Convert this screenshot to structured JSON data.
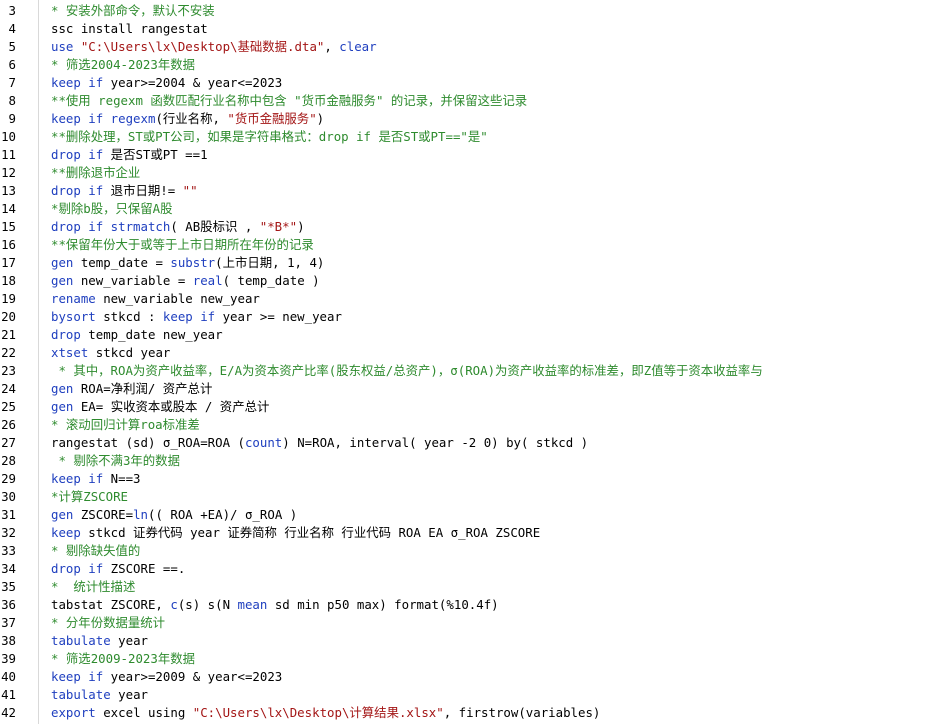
{
  "editor": {
    "lines": [
      {
        "n": "3",
        "parts": [
          {
            "t": "* 安装外部命令，默认不安装",
            "c": "cmt"
          }
        ]
      },
      {
        "n": "4",
        "parts": [
          {
            "t": "ssc install rangestat",
            "c": "plain"
          }
        ]
      },
      {
        "n": "5",
        "parts": [
          {
            "t": "use ",
            "c": "kw"
          },
          {
            "t": "\"C:\\Users\\lx\\Desktop\\基础数据.dta\"",
            "c": "str"
          },
          {
            "t": ", ",
            "c": "plain"
          },
          {
            "t": "clear",
            "c": "kw"
          }
        ]
      },
      {
        "n": "6",
        "parts": [
          {
            "t": "* 筛选2004-2023年数据",
            "c": "cmt"
          }
        ]
      },
      {
        "n": "7",
        "parts": [
          {
            "t": "keep if",
            "c": "kw"
          },
          {
            "t": " year>=2004 & year<=2023",
            "c": "plain"
          }
        ]
      },
      {
        "n": "8",
        "parts": [
          {
            "t": "**使用 regexm 函数匹配行业名称中包含 \"货币金融服务\" 的记录，并保留这些记录",
            "c": "cmt"
          }
        ]
      },
      {
        "n": "9",
        "parts": [
          {
            "t": "keep if regexm",
            "c": "kw"
          },
          {
            "t": "(行业名称, ",
            "c": "plain"
          },
          {
            "t": "\"货币金融服务\"",
            "c": "str"
          },
          {
            "t": ")",
            "c": "plain"
          }
        ]
      },
      {
        "n": "10",
        "parts": [
          {
            "t": "**删除处理，ST或PT公司，如果是字符串格式：drop if 是否ST或PT==\"是\"",
            "c": "cmt"
          }
        ]
      },
      {
        "n": "11",
        "parts": [
          {
            "t": "drop if",
            "c": "kw"
          },
          {
            "t": " 是否ST或PT ==1",
            "c": "plain"
          }
        ]
      },
      {
        "n": "12",
        "parts": [
          {
            "t": "**删除退市企业",
            "c": "cmt"
          }
        ]
      },
      {
        "n": "13",
        "parts": [
          {
            "t": "drop if",
            "c": "kw"
          },
          {
            "t": " 退市日期!= ",
            "c": "plain"
          },
          {
            "t": "\"\"",
            "c": "str"
          }
        ]
      },
      {
        "n": "14",
        "parts": [
          {
            "t": "*剔除b股，只保留A股",
            "c": "cmt"
          }
        ]
      },
      {
        "n": "15",
        "parts": [
          {
            "t": "drop if strmatch",
            "c": "kw"
          },
          {
            "t": "( AB股标识 , ",
            "c": "plain"
          },
          {
            "t": "\"*B*\"",
            "c": "str"
          },
          {
            "t": ")",
            "c": "plain"
          }
        ]
      },
      {
        "n": "16",
        "parts": [
          {
            "t": "**保留年份大于或等于上市日期所在年份的记录",
            "c": "cmt"
          }
        ]
      },
      {
        "n": "17",
        "parts": [
          {
            "t": "gen",
            "c": "kw"
          },
          {
            "t": " temp_date = ",
            "c": "plain"
          },
          {
            "t": "substr",
            "c": "kw"
          },
          {
            "t": "(上市日期, 1, 4)",
            "c": "plain"
          }
        ]
      },
      {
        "n": "18",
        "parts": [
          {
            "t": "gen",
            "c": "kw"
          },
          {
            "t": " new_variable = ",
            "c": "plain"
          },
          {
            "t": "real",
            "c": "kw"
          },
          {
            "t": "( temp_date )",
            "c": "plain"
          }
        ]
      },
      {
        "n": "19",
        "parts": [
          {
            "t": "rename",
            "c": "kw"
          },
          {
            "t": " new_variable new_year",
            "c": "plain"
          }
        ]
      },
      {
        "n": "20",
        "parts": [
          {
            "t": "bysort",
            "c": "kw"
          },
          {
            "t": " stkcd : ",
            "c": "plain"
          },
          {
            "t": "keep if",
            "c": "kw"
          },
          {
            "t": " year >= new_year",
            "c": "plain"
          }
        ]
      },
      {
        "n": "21",
        "parts": [
          {
            "t": "drop",
            "c": "kw"
          },
          {
            "t": " temp_date new_year",
            "c": "plain"
          }
        ]
      },
      {
        "n": "22",
        "parts": [
          {
            "t": "xtset",
            "c": "kw"
          },
          {
            "t": " stkcd year",
            "c": "plain"
          }
        ]
      },
      {
        "n": "23",
        "parts": [
          {
            "t": " * 其中，ROA为资产收益率，E/A为资本资产比率(股东权益/总资产)，σ(ROA)为资产收益率的标准差，即Z值等于资本收益率与",
            "c": "cmt"
          }
        ]
      },
      {
        "n": "24",
        "parts": [
          {
            "t": "gen",
            "c": "kw"
          },
          {
            "t": " ROA=净利润/ 资产总计",
            "c": "plain"
          }
        ]
      },
      {
        "n": "25",
        "parts": [
          {
            "t": "gen",
            "c": "kw"
          },
          {
            "t": " EA= 实收资本或股本 / 资产总计",
            "c": "plain"
          }
        ]
      },
      {
        "n": "26",
        "parts": [
          {
            "t": "* 滚动回归计算roa标准差",
            "c": "cmt"
          }
        ]
      },
      {
        "n": "27",
        "parts": [
          {
            "t": "rangestat (sd) σ_ROA=ROA (",
            "c": "plain"
          },
          {
            "t": "count",
            "c": "kw"
          },
          {
            "t": ") N=ROA, interval( year -2 0) by( stkcd )",
            "c": "plain"
          }
        ]
      },
      {
        "n": "28",
        "parts": [
          {
            "t": " * 剔除不满3年的数据",
            "c": "cmt"
          }
        ]
      },
      {
        "n": "29",
        "parts": [
          {
            "t": "keep if",
            "c": "kw"
          },
          {
            "t": " N==3",
            "c": "plain"
          }
        ]
      },
      {
        "n": "30",
        "parts": [
          {
            "t": "*计算ZSCORE",
            "c": "cmt"
          }
        ]
      },
      {
        "n": "31",
        "parts": [
          {
            "t": "gen",
            "c": "kw"
          },
          {
            "t": " ZSCORE=",
            "c": "plain"
          },
          {
            "t": "ln",
            "c": "kw"
          },
          {
            "t": "(( ROA +EA)/ σ_ROA )",
            "c": "plain"
          }
        ]
      },
      {
        "n": "32",
        "parts": [
          {
            "t": "keep",
            "c": "kw"
          },
          {
            "t": " stkcd 证券代码 year 证券简称 行业名称 行业代码 ROA EA σ_ROA ZSCORE",
            "c": "plain"
          }
        ]
      },
      {
        "n": "33",
        "parts": [
          {
            "t": "* 剔除缺失值的",
            "c": "cmt"
          }
        ]
      },
      {
        "n": "34",
        "parts": [
          {
            "t": "drop if",
            "c": "kw"
          },
          {
            "t": " ZSCORE ==.",
            "c": "plain"
          }
        ]
      },
      {
        "n": "35",
        "parts": [
          {
            "t": "*  统计性描述",
            "c": "cmt"
          }
        ]
      },
      {
        "n": "36",
        "parts": [
          {
            "t": "tabstat ZSCORE, ",
            "c": "plain"
          },
          {
            "t": "c",
            "c": "kw"
          },
          {
            "t": "(s) s(N ",
            "c": "plain"
          },
          {
            "t": "mean",
            "c": "kw"
          },
          {
            "t": " sd min p50 max) format(%10.4f)",
            "c": "plain"
          }
        ]
      },
      {
        "n": "37",
        "parts": [
          {
            "t": "* 分年份数据量统计",
            "c": "cmt"
          }
        ]
      },
      {
        "n": "38",
        "parts": [
          {
            "t": "tabulate",
            "c": "kw"
          },
          {
            "t": " year",
            "c": "plain"
          }
        ]
      },
      {
        "n": "39",
        "parts": [
          {
            "t": "* 筛选2009-2023年数据",
            "c": "cmt"
          }
        ]
      },
      {
        "n": "40",
        "parts": [
          {
            "t": "keep if",
            "c": "kw"
          },
          {
            "t": " year>=2009 & year<=2023",
            "c": "plain"
          }
        ]
      },
      {
        "n": "41",
        "parts": [
          {
            "t": "tabulate",
            "c": "kw"
          },
          {
            "t": " year",
            "c": "plain"
          }
        ]
      },
      {
        "n": "42",
        "parts": [
          {
            "t": "export",
            "c": "kw"
          },
          {
            "t": " excel using ",
            "c": "plain"
          },
          {
            "t": "\"C:\\Users\\lx\\Desktop\\计算结果.xlsx\"",
            "c": "str"
          },
          {
            "t": ", firstrow(variables)",
            "c": "plain"
          }
        ]
      }
    ]
  }
}
